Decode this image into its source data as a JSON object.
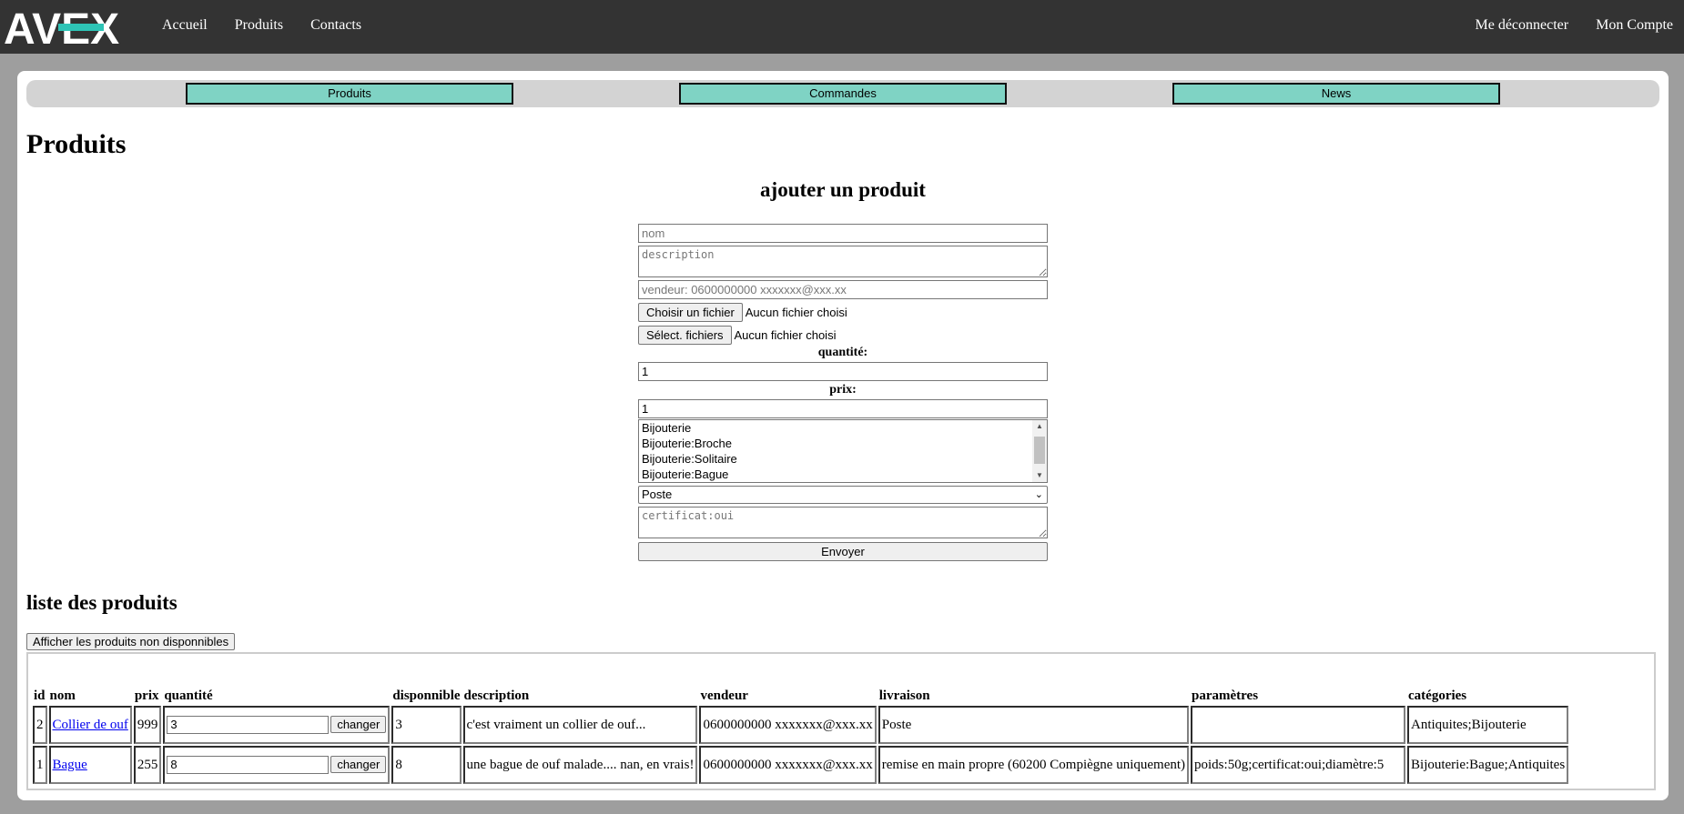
{
  "brand": {
    "logo_text": "AVEX"
  },
  "nav": {
    "left": [
      "Accueil",
      "Produits",
      "Contacts"
    ],
    "right": [
      "Me déconnecter",
      "Mon Compte"
    ]
  },
  "subnav": [
    "Produits",
    "Commandes",
    "News"
  ],
  "page_title": "Produits",
  "form": {
    "title": "ajouter un produit",
    "nom_placeholder": "nom",
    "description_placeholder": "description",
    "vendeur_placeholder": "vendeur: 0600000000 xxxxxxx@xxx.xx",
    "file1": {
      "button": "Choisir un fichier",
      "status": "Aucun fichier choisi"
    },
    "file2": {
      "button": "Sélect. fichiers",
      "status": "Aucun fichier choisi"
    },
    "quantite_label": "quantité:",
    "quantite_value": "1",
    "prix_label": "prix:",
    "prix_value": "1",
    "categories": [
      "Bijouterie",
      "Bijouterie:Broche",
      "Bijouterie:Solitaire",
      "Bijouterie:Bague"
    ],
    "livraison_selected": "Poste",
    "params_placeholder": "certificat:oui",
    "submit": "Envoyer"
  },
  "list": {
    "title": "liste des produits",
    "toggle_button": "Afficher les produits non disponnibles",
    "columns": [
      "id",
      "nom",
      "prix",
      "quantité",
      "disponnible",
      "description",
      "vendeur",
      "livraison",
      "paramètres",
      "catégories"
    ],
    "change_label": "changer",
    "rows": [
      {
        "id": "2",
        "nom": "Collier de ouf",
        "prix": "999",
        "quantite": "3",
        "disponnible": "3",
        "description": "c'est vraiment un collier de ouf...",
        "vendeur": "0600000000 xxxxxxx@xxx.xx",
        "livraison": "Poste",
        "parametres": "",
        "categories": "Antiquites;Bijouterie"
      },
      {
        "id": "1",
        "nom": "Bague",
        "prix": "255",
        "quantite": "8",
        "disponnible": "8",
        "description": "une bague de ouf malade.... nan, en vrais!",
        "vendeur": "0600000000 xxxxxxx@xxx.xx",
        "livraison": "remise en main propre (60200 Compiègne uniquement)",
        "parametres": "poids:50g;certificat:oui;diamètre:5",
        "categories": "Bijouterie:Bague;Antiquites"
      }
    ]
  },
  "colors": {
    "topbar": "#333333",
    "accent": "#7fd3c4",
    "logo_teal": "#2ec4b6"
  }
}
